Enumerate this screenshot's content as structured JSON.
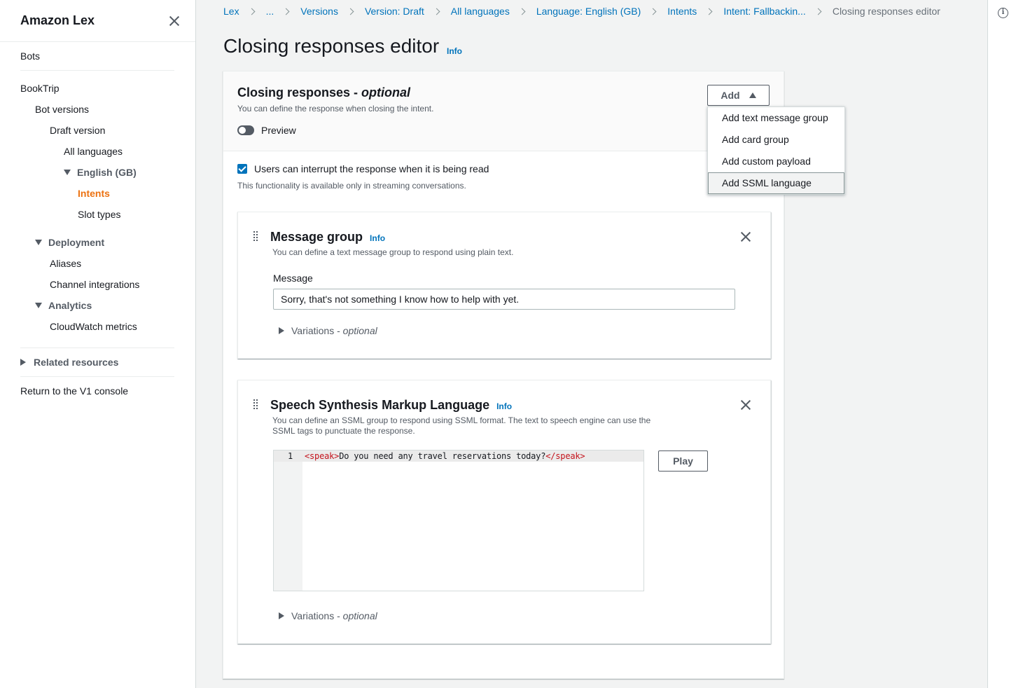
{
  "sidebar": {
    "title": "Amazon Lex",
    "items": {
      "bots": "Bots",
      "booktrip": "BookTrip",
      "bot_versions": "Bot versions",
      "draft_version": "Draft version",
      "all_languages": "All languages",
      "english_gb": "English (GB)",
      "intents": "Intents",
      "slot_types": "Slot types",
      "deployment": "Deployment",
      "aliases": "Aliases",
      "channel_integrations": "Channel integrations",
      "analytics": "Analytics",
      "cloudwatch_metrics": "CloudWatch metrics",
      "related_resources": "Related resources",
      "return_v1": "Return to the V1 console"
    },
    "active_color": "#ec7211"
  },
  "breadcrumb": {
    "items": [
      "Lex",
      "...",
      "Versions",
      "Version: Draft",
      "All languages",
      "Language: English (GB)",
      "Intents",
      "Intent: Fallbackin..."
    ],
    "current": "Closing responses editor"
  },
  "page": {
    "title": "Closing responses editor",
    "info": "Info"
  },
  "closing": {
    "title": "Closing responses - ",
    "title_optional": "optional",
    "description": "You can define the response when closing the intent.",
    "preview_label": "Preview",
    "interrupt_label": "Users can interrupt the response when it is being read",
    "interrupt_desc": "This functionality is available only in streaming conversations.",
    "add_button": "Add"
  },
  "add_menu": {
    "items": [
      "Add text message group",
      "Add card group",
      "Add custom payload",
      "Add SSML language"
    ]
  },
  "message_group": {
    "title": "Message group",
    "info": "Info",
    "description": "You can define a text message group to respond using plain text.",
    "message_label": "Message",
    "message_value": "Sorry, that's not something I know how to help with yet.",
    "variations": "Variations - ",
    "variations_optional": "optional"
  },
  "ssml": {
    "title": "Speech Synthesis Markup Language",
    "info": "Info",
    "description": "You can define an SSML group to respond using SSML format. The text to speech engine can use the SSML tags to punctuate the response.",
    "line_number": "1",
    "code_open_tag": "<speak>",
    "code_text": "Do you need any travel reservations today?",
    "code_close_tag": "</speak>",
    "play_button": "Play",
    "variations": "Variations - ",
    "variations_optional": "optional"
  },
  "colors": {
    "link": "#0073bb",
    "accent_orange": "#ec7211",
    "code_tag": "#c4131c"
  }
}
